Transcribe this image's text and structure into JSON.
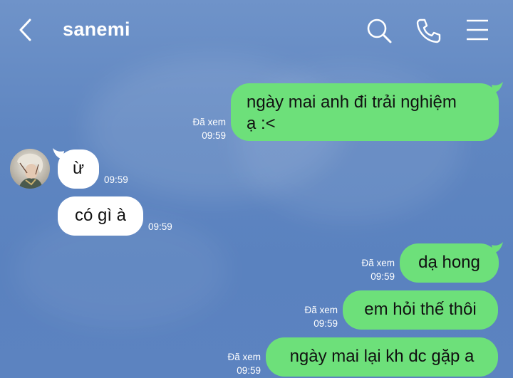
{
  "header": {
    "title": "sanemi",
    "icons": [
      "chevron-left-icon",
      "search-icon",
      "phone-icon",
      "menu-icon"
    ]
  },
  "messages": [
    {
      "direction": "out",
      "text_line1": "ngày mai anh đi trải nghiệm",
      "text_line2": "ạ :<",
      "read": "Đã xem",
      "time": "09:59"
    },
    {
      "direction": "in",
      "text": "ừ",
      "time": "09:59"
    },
    {
      "direction": "in",
      "text": "có gì à",
      "time": "09:59"
    },
    {
      "direction": "out",
      "text": "dạ hong",
      "read": "Đã xem",
      "time": "09:59"
    },
    {
      "direction": "out",
      "text": "em hỏi thế thôi",
      "read": "Đã xem",
      "time": "09:59"
    },
    {
      "direction": "out",
      "text": "ngày mai lại kh dc gặp a",
      "read": "Đã xem",
      "time": "09:59"
    }
  ],
  "colors": {
    "outgoing_bubble": "#6de07a",
    "incoming_bubble": "#ffffff",
    "background": "#6088c2"
  }
}
